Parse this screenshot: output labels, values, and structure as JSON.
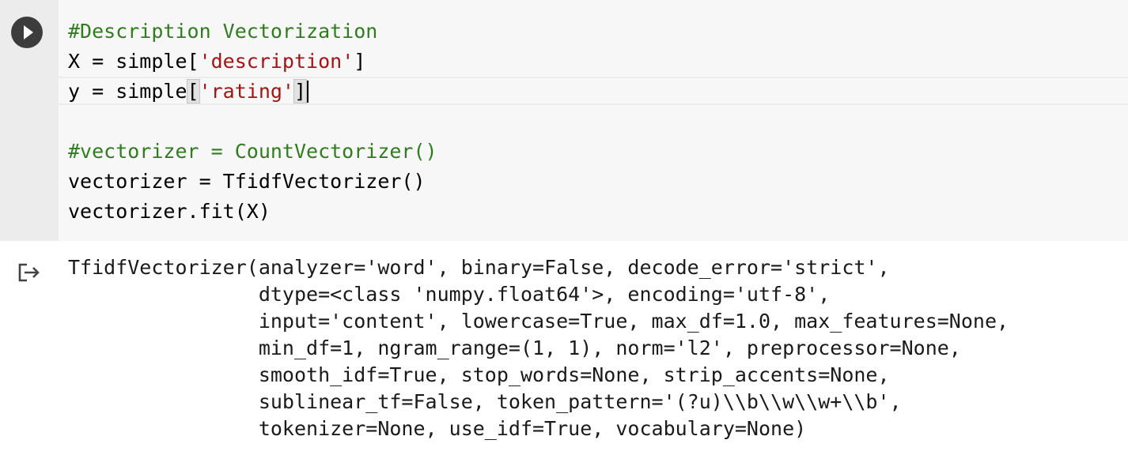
{
  "cell": {
    "run_button_icon": "play-icon",
    "output_icon": "output-arrow-icon",
    "code_lines": [
      "#Description Vectorization",
      "X = simple['description']",
      "y = simple['rating']",
      "",
      "#vectorizer = CountVectorizer()",
      "vectorizer = TfidfVectorizer()",
      "vectorizer.fit(X)"
    ],
    "tokens": {
      "line1_comment": "#Description Vectorization",
      "line2_prefix": "X = simple[",
      "line2_string": "'description'",
      "line2_suffix": "]",
      "line3_prefix": "y = simple",
      "line3_open_bracket": "[",
      "line3_string": "'rating'",
      "line3_close_bracket": "]",
      "line5_comment": "#vectorizer = CountVectorizer()",
      "line6": "vectorizer = TfidfVectorizer()",
      "line7": "vectorizer.fit(X)"
    },
    "output_lines": [
      "TfidfVectorizer(analyzer='word', binary=False, decode_error='strict',",
      "                dtype=<class 'numpy.float64'>, encoding='utf-8',",
      "                input='content', lowercase=True, max_df=1.0, max_features=None,",
      "                min_df=1, ngram_range=(1, 1), norm='l2', preprocessor=None,",
      "                smooth_idf=True, stop_words=None, strip_accents=None,",
      "                sublinear_tf=False, token_pattern='(?u)\\\\b\\\\w\\\\w+\\\\b',",
      "                tokenizer=None, use_idf=True, vocabulary=None)"
    ]
  },
  "colors": {
    "comment": "#2f7d1e",
    "string": "#a31515",
    "code_background": "#f7f7f7",
    "gutter_background": "#ececec",
    "run_button": "#3c3c3c"
  }
}
